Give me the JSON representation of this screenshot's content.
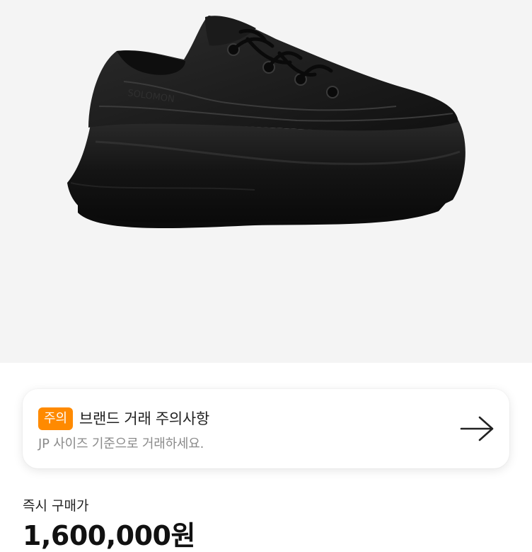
{
  "notice": {
    "badge": "주의",
    "title": "브랜드 거래 주의사항",
    "subtitle": "JP 사이즈 기준으로 거래하세요."
  },
  "price": {
    "label": "즉시 구매가",
    "value": "1,600,000원"
  },
  "colors": {
    "badge": "#ff8a00",
    "hero_background": "#f4f4f4"
  },
  "icons": {
    "notice_arrow": "arrow-right-icon"
  }
}
